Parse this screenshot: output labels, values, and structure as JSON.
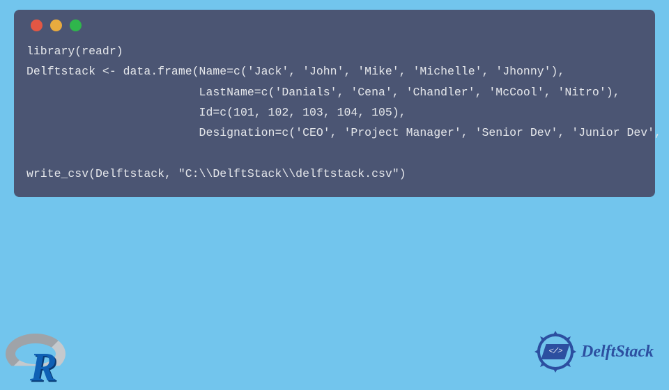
{
  "code": {
    "line1": "library(readr)",
    "line2": "Delftstack <- data.frame(Name=c('Jack', 'John', 'Mike', 'Michelle', 'Jhonny'),",
    "line3": "                         LastName=c('Danials', 'Cena', 'Chandler', 'McCool', 'Nitro'),",
    "line4": "                         Id=c(101, 102, 103, 104, 105),",
    "line5": "                         Designation=c('CEO', 'Project Manager', 'Senior Dev', 'Junior Dev', 'Intern'))",
    "line6": "",
    "line7": "write_csv(Delftstack, \"C:\\\\DelftStack\\\\delftstack.csv\")"
  },
  "brand": {
    "name": "DelftStack",
    "badge_glyph": "</>"
  },
  "logo": {
    "letter": "R"
  }
}
